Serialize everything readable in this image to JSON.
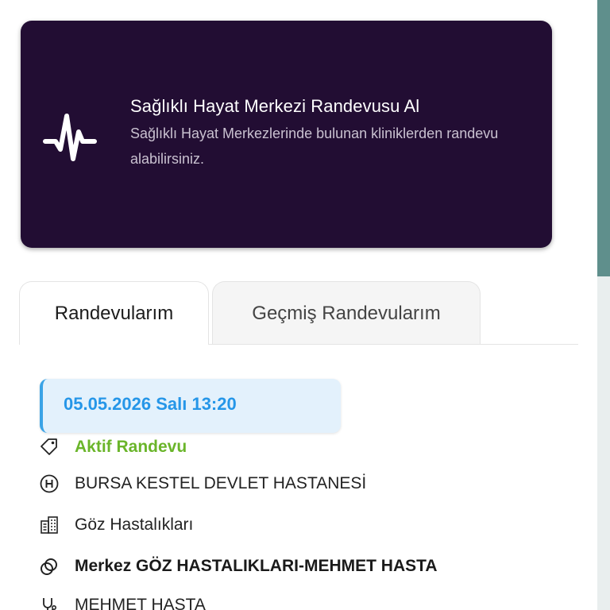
{
  "hero": {
    "icon": "heartbeat-icon",
    "title": "Sağlıklı Hayat Merkezi Randevusu Al",
    "description": "Sağlıklı Hayat Merkezlerinde bulunan kliniklerden randevu alabilirsiniz.",
    "background": "#220d33"
  },
  "tabs": [
    {
      "label": "Randevularım",
      "active": true
    },
    {
      "label": "Geçmiş Randevularım",
      "active": false
    }
  ],
  "appointment": {
    "datetime": "05.05.2026 Salı 13:20",
    "status": "Aktif Randevu",
    "hospital": "BURSA KESTEL DEVLET HASTANESİ",
    "clinic": "Göz Hastalıkları",
    "place": "Merkez GÖZ HASTALIKLARI-MEHMET HASTA",
    "doctor": "MEHMET HASTA",
    "icons": [
      "tag-icon",
      "hospital-icon",
      "building-icon",
      "location-icon",
      "stethoscope-icon"
    ]
  },
  "colors": {
    "status": "#6ab52a",
    "date": "#2596e8",
    "scrollbar": "#5f8f8c"
  }
}
